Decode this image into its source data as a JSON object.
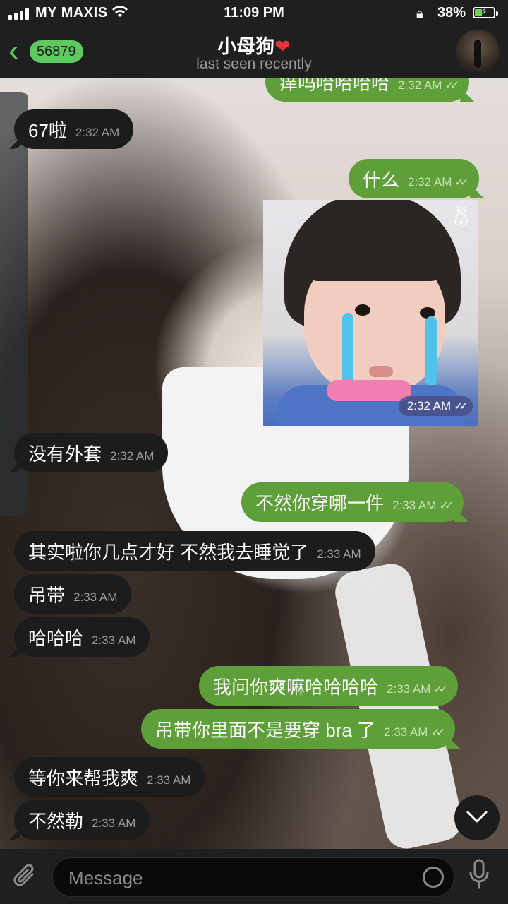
{
  "status": {
    "carrier": "MY MAXIS",
    "time": "11:09 PM",
    "battery": "38%",
    "battery_level": 0.38
  },
  "header": {
    "back_count": "56879",
    "title": "小母狗",
    "title_emoji": "❤️",
    "subtitle": "last seen recently"
  },
  "messages": [
    {
      "dir": "out",
      "text": "痒吗哈哈哈哈",
      "time": "2:32 AM",
      "read": true
    },
    {
      "dir": "in",
      "text": "67啦",
      "time": "2:32 AM"
    },
    {
      "dir": "out",
      "text": "什么",
      "time": "2:32 AM",
      "read": true
    },
    {
      "dir": "out",
      "type": "sticker",
      "time": "2:32 AM",
      "read": true
    },
    {
      "dir": "in",
      "text": "没有外套",
      "time": "2:32 AM"
    },
    {
      "dir": "out",
      "text": "不然你穿哪一件",
      "time": "2:33 AM",
      "read": true
    },
    {
      "dir": "in",
      "text": "其实啦你几点才好 不然我去睡觉了",
      "time": "2:33 AM"
    },
    {
      "dir": "in",
      "text": "吊带",
      "time": "2:33 AM"
    },
    {
      "dir": "in",
      "text": "哈哈哈",
      "time": "2:33 AM"
    },
    {
      "dir": "out",
      "text": "我问你爽嘛哈哈哈哈",
      "time": "2:33 AM",
      "read": true
    },
    {
      "dir": "out",
      "text": "吊带你里面不是要穿 bra 了",
      "time": "2:33 AM",
      "read": true
    },
    {
      "dir": "in",
      "text": "等你来帮我爽",
      "time": "2:33 AM"
    },
    {
      "dir": "in",
      "text": "不然勒",
      "time": "2:33 AM"
    }
  ],
  "input": {
    "placeholder": "Message"
  },
  "icons": {
    "back": "chevron-left-icon",
    "attach": "paperclip-icon",
    "sticker": "sticker-icon",
    "mic": "microphone-icon",
    "scroll": "chevron-down-icon"
  },
  "colors": {
    "accent": "#5ec95e",
    "outgoing": "#5f9f3a",
    "incoming": "#1c1c1c",
    "heart": "#e4343c",
    "tear": "#4fc3ea"
  }
}
